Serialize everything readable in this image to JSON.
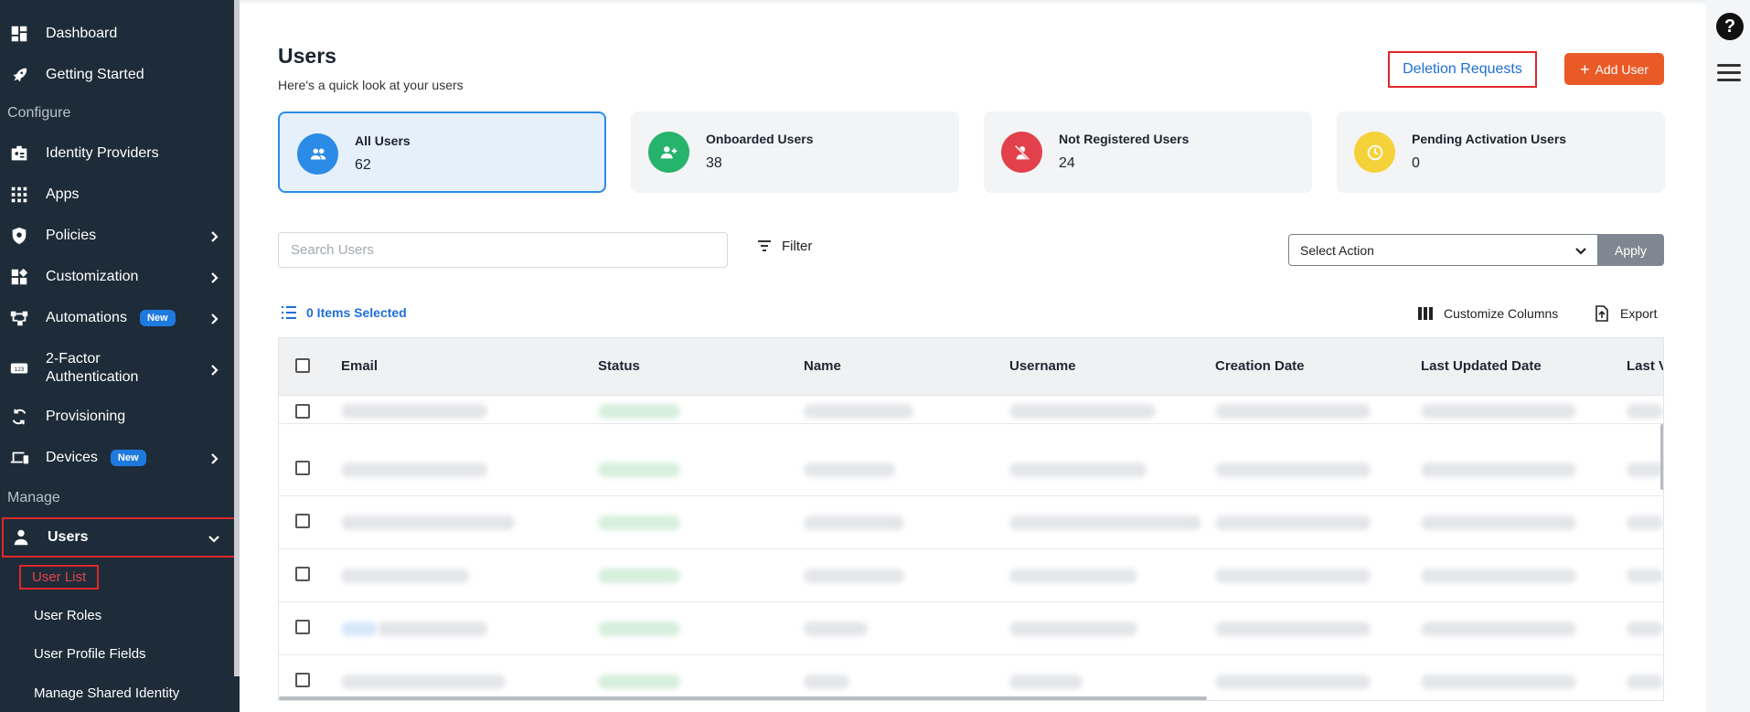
{
  "sidebar": {
    "items": [
      {
        "label": "Dashboard"
      },
      {
        "label": "Getting Started"
      },
      {
        "label": "Identity Providers"
      },
      {
        "label": "Apps"
      },
      {
        "label": "Policies"
      },
      {
        "label": "Customization"
      },
      {
        "label": "Automations",
        "badge": "New"
      },
      {
        "label_line1": "2-Factor",
        "label_line2": "Authentication"
      },
      {
        "label": "Provisioning"
      },
      {
        "label": "Devices",
        "badge": "New"
      },
      {
        "label": "Users"
      }
    ],
    "sections": {
      "configure": "Configure",
      "manage": "Manage"
    },
    "sub_items": [
      "User List",
      "User Roles",
      "User Profile Fields",
      "Manage Shared Identity"
    ],
    "icons": [
      "dashboard-icon",
      "rocket-icon",
      "id-card-icon",
      "apps-grid-icon",
      "shield-icon",
      "customize-icon",
      "automation-icon",
      "two-factor-icon",
      "sync-icon",
      "devices-icon",
      "user-icon"
    ]
  },
  "header": {
    "title": "Users",
    "subtitle": "Here's a quick look at your users",
    "deletion_requests": "Deletion Requests",
    "add_user": "Add User"
  },
  "stats": [
    {
      "label": "All Users",
      "value": "62",
      "color": "#2b8be6"
    },
    {
      "label": "Onboarded Users",
      "value": "38",
      "color": "#26b36b"
    },
    {
      "label": "Not Registered Users",
      "value": "24",
      "color": "#e2414b"
    },
    {
      "label": "Pending Activation Users",
      "value": "0",
      "color": "#f6d23a"
    }
  ],
  "toolbar": {
    "search_placeholder": "Search Users",
    "filter": "Filter",
    "select_action": "Select Action",
    "apply": "Apply",
    "items_selected": "0 Items Selected",
    "customize_columns": "Customize Columns",
    "export": "Export"
  },
  "table": {
    "columns": [
      "Email",
      "Status",
      "Name",
      "Username",
      "Creation Date",
      "Last Updated Date",
      "Last V"
    ]
  },
  "rail": {
    "help": "?"
  }
}
